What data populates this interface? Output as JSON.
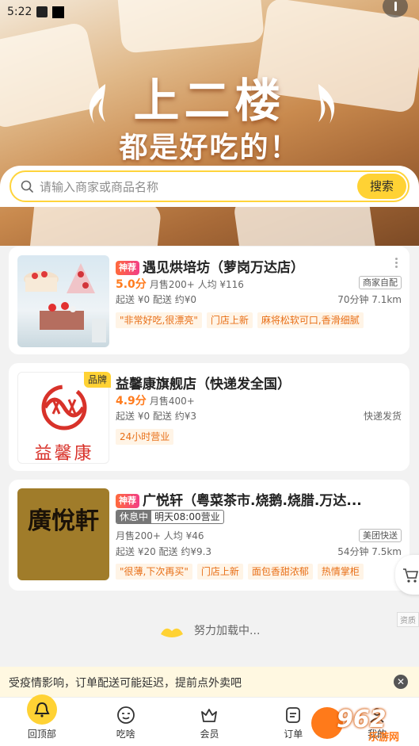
{
  "status_bar": {
    "time": "5:22"
  },
  "hero": {
    "title": "上二楼",
    "subtitle": "都是好吃的！"
  },
  "search": {
    "placeholder": "请输入商家或商品名称",
    "button": "搜索"
  },
  "stores": [
    {
      "tag": "神荐",
      "name": "遇见烘培坊（萝岗万达店）",
      "rating": "5.0分",
      "sales": "月售200+  人均 ¥116",
      "delivery": "起送 ¥0  配送 约¥0",
      "badge": "商家自配",
      "time_distance": "70分钟  7.1km",
      "chips": [
        "\"非常好吃,很漂亮\"",
        "门店上新",
        "麻将松软可口,香滑细腻"
      ]
    },
    {
      "brand": "品牌",
      "name": "益馨康旗舰店（快递发全国）",
      "logo_text": "益馨康",
      "rating": "4.9分",
      "sales": "月售400+",
      "delivery": "起送 ¥0  配送 约¥3",
      "shipping": "快递发货",
      "chips": [
        "24小时营业"
      ]
    },
    {
      "tag": "神荐",
      "name": "广悦轩（粤菜茶市.烧鹅.烧腊.万达...",
      "logo_text": "廣悅軒",
      "status_closed": "休息中",
      "status_open": "明天08:00营业",
      "sales": "月售200+  人均 ¥46",
      "delivery": "起送 ¥20  配送 约¥9.3",
      "badge": "美团快送",
      "time_distance": "54分钟  7.5km",
      "chips": [
        "\"很薄,下次再买\"",
        "门店上新",
        "面包香甜浓郁",
        "热情掌柜"
      ]
    }
  ],
  "loading_text": "努力加载中...",
  "side_tag": "资质",
  "notice": {
    "text": "受疫情影响，订单配送可能延迟，提前点外卖吧"
  },
  "tabs": [
    {
      "label": "回顶部",
      "icon": "bell-icon"
    },
    {
      "label": "吃啥",
      "icon": "smile-icon"
    },
    {
      "label": "会员",
      "icon": "crown-bag-icon"
    },
    {
      "label": "订单",
      "icon": "order-icon"
    },
    {
      "label": "我的",
      "icon": "user-icon"
    }
  ],
  "watermark": {
    "text": "962",
    "sub": "乐游网"
  }
}
